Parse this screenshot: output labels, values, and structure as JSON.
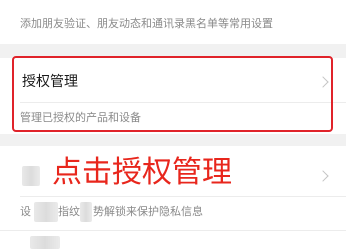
{
  "top_item": {
    "description": "添加朋友验证、朋友动态和通讯录黑名单等常用设置"
  },
  "authorization_item": {
    "title": "授权管理",
    "description": "管理已授权的产品和设备"
  },
  "annotation": {
    "text": "点击授权管理",
    "color": "#e8261c"
  },
  "next_item": {
    "description_fragment_1": "设",
    "description_fragment_2": "指纹",
    "description_fragment_3": "势解锁来保护隐私信息"
  }
}
